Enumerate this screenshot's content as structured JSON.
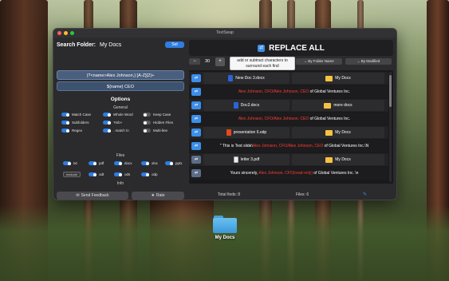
{
  "window": {
    "title": "TextSwap"
  },
  "desktop": {
    "folder_label": "My Docs"
  },
  "search": {
    "label": "Search Folder:",
    "folder": "My Docs",
    "set_label": "Set"
  },
  "patterns": {
    "find": "(?<name>Alex Johnson,) [A-Z]{2}+",
    "replace": "${name} CEO"
  },
  "options": {
    "title": "Options",
    "general_title": "General",
    "general": [
      {
        "label": "Match Case",
        "on": true
      },
      {
        "label": "Whole Word",
        "on": true
      },
      {
        "label": "Keep Case",
        "on": false
      },
      {
        "label": "Subfolders",
        "on": true
      },
      {
        "label": "?mb+",
        "on": true
      },
      {
        "label": "Hidden Files",
        "on": false
      },
      {
        "label": "Regex",
        "on": true
      },
      {
        "label": ". match \\n",
        "on": true
      },
      {
        "label": "Multi-line",
        "on": false
      }
    ],
    "files_title": "Files",
    "files": [
      {
        "label": "txt",
        "on": true
      },
      {
        "label": "pdf",
        "on": true
      },
      {
        "label": "docx",
        "on": true
      },
      {
        "label": "xlsx",
        "on": true
      },
      {
        "label": "pptx",
        "on": true
      },
      {
        "label": "odt",
        "on": true
      },
      {
        "label": "ods",
        "on": true
      },
      {
        "label": "odp",
        "on": true
      }
    ],
    "exclude_label": "exclude",
    "info_title": "Info"
  },
  "footer": {
    "feedback_label": "Send Feedback",
    "rate_label": "Rate"
  },
  "toolbar": {
    "replace_all": "REPLACE ALL",
    "minus": "−",
    "count": "30",
    "plus": "+",
    "tooltip": "add or subtract characters to surround each find",
    "sort_folder": "By Folder Name",
    "sort_modified": "By Modified"
  },
  "results": [
    {
      "kind": "file",
      "name": "New Doc 3.docx",
      "type": "docx",
      "folder": "My Docs"
    },
    {
      "kind": "line",
      "before": "",
      "match": "Alex Johnson, CFO/Alex Johnson, CEO",
      "after": " of Global Ventures Inc."
    },
    {
      "kind": "file",
      "name": "Doc2.docx",
      "type": "docx",
      "folder": "more docs"
    },
    {
      "kind": "line",
      "before": "",
      "match": "Alex Johnson, CFO/Alex Johnson, CEO",
      "after": " of Global Ventures Inc."
    },
    {
      "kind": "file",
      "name": "presentation 6.odp",
      "type": "odp",
      "folder": "My Docs"
    },
    {
      "kind": "line",
      "before": "\" This is Test slide\\",
      "match": "Alex Johnson, CFO/Alex Johnson, CEO",
      "after": " of Global Ventures Inc.\\N"
    },
    {
      "kind": "file",
      "name": "letter 3.pdf",
      "type": "pdf",
      "folder": "My Docs"
    },
    {
      "kind": "line",
      "before": "Yours sincerely, ",
      "match": "Alex Johnson, CFO(read-only)",
      "after": " of Global Ventures Inc. \\n"
    }
  ],
  "status": {
    "total": "Total finds: 8",
    "files": "Files: 6"
  }
}
